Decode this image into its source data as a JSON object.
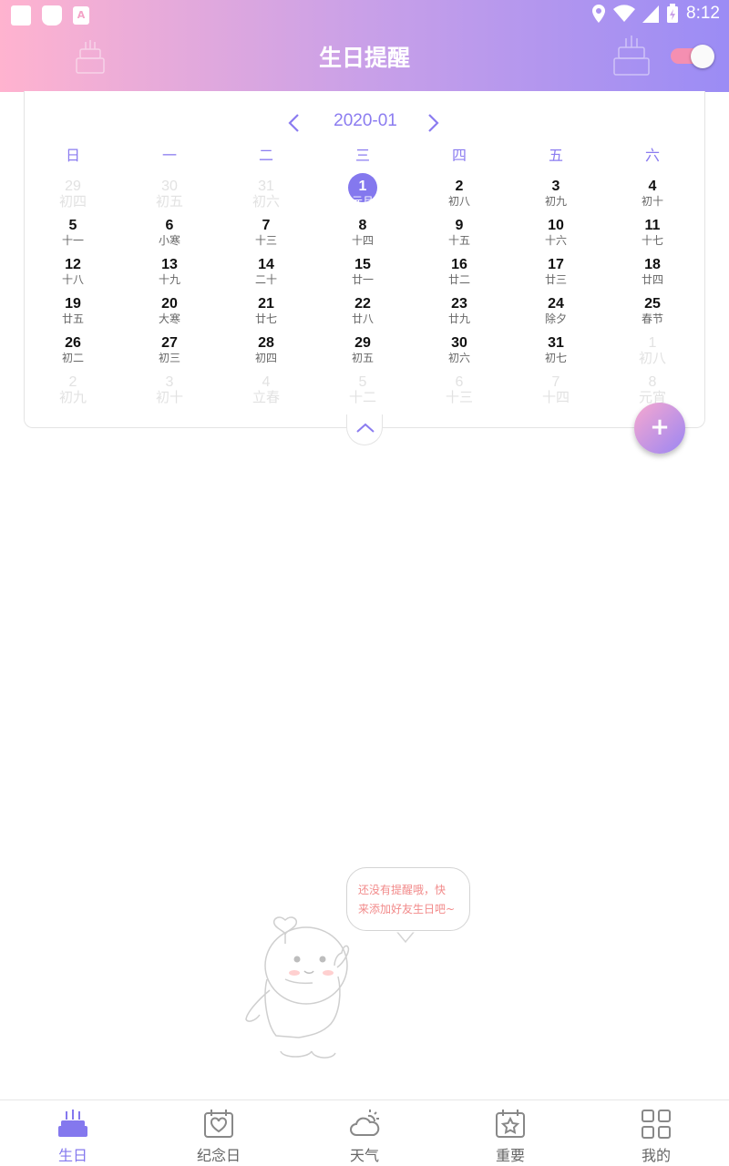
{
  "status_bar": {
    "time": "8:12"
  },
  "header": {
    "title": "生日提醒",
    "reminder_toggle_on": true
  },
  "calendar": {
    "month_label": "2020-01",
    "weekdays": [
      "日",
      "一",
      "二",
      "三",
      "四",
      "五",
      "六"
    ],
    "weeks": [
      [
        {
          "d": "29",
          "l": "初四",
          "o": true
        },
        {
          "d": "30",
          "l": "初五",
          "o": true
        },
        {
          "d": "31",
          "l": "初六",
          "o": true
        },
        {
          "d": "1",
          "l": "元旦",
          "sel": true
        },
        {
          "d": "2",
          "l": "初八"
        },
        {
          "d": "3",
          "l": "初九"
        },
        {
          "d": "4",
          "l": "初十"
        }
      ],
      [
        {
          "d": "5",
          "l": "十一"
        },
        {
          "d": "6",
          "l": "小寒"
        },
        {
          "d": "7",
          "l": "十三"
        },
        {
          "d": "8",
          "l": "十四"
        },
        {
          "d": "9",
          "l": "十五"
        },
        {
          "d": "10",
          "l": "十六"
        },
        {
          "d": "11",
          "l": "十七"
        }
      ],
      [
        {
          "d": "12",
          "l": "十八"
        },
        {
          "d": "13",
          "l": "十九"
        },
        {
          "d": "14",
          "l": "二十"
        },
        {
          "d": "15",
          "l": "廿一"
        },
        {
          "d": "16",
          "l": "廿二"
        },
        {
          "d": "17",
          "l": "廿三"
        },
        {
          "d": "18",
          "l": "廿四"
        }
      ],
      [
        {
          "d": "19",
          "l": "廿五"
        },
        {
          "d": "20",
          "l": "大寒"
        },
        {
          "d": "21",
          "l": "廿七"
        },
        {
          "d": "22",
          "l": "廿八"
        },
        {
          "d": "23",
          "l": "廿九"
        },
        {
          "d": "24",
          "l": "除夕"
        },
        {
          "d": "25",
          "l": "春节"
        }
      ],
      [
        {
          "d": "26",
          "l": "初二"
        },
        {
          "d": "27",
          "l": "初三"
        },
        {
          "d": "28",
          "l": "初四"
        },
        {
          "d": "29",
          "l": "初五"
        },
        {
          "d": "30",
          "l": "初六"
        },
        {
          "d": "31",
          "l": "初七"
        },
        {
          "d": "1",
          "l": "初八",
          "o": true
        }
      ],
      [
        {
          "d": "2",
          "l": "初九",
          "o": true
        },
        {
          "d": "3",
          "l": "初十",
          "o": true
        },
        {
          "d": "4",
          "l": "立春",
          "o": true
        },
        {
          "d": "5",
          "l": "十二",
          "o": true
        },
        {
          "d": "6",
          "l": "十三",
          "o": true
        },
        {
          "d": "7",
          "l": "十四",
          "o": true
        },
        {
          "d": "8",
          "l": "元宵",
          "o": true
        }
      ]
    ]
  },
  "fab": {
    "label": "+"
  },
  "empty_state": {
    "line1": "还没有提醒哦，快",
    "line2": "来添加好友生日吧~"
  },
  "tabs": [
    {
      "label": "生日",
      "icon": "cake-icon",
      "active": true
    },
    {
      "label": "纪念日",
      "icon": "calendar-heart-icon"
    },
    {
      "label": "天气",
      "icon": "weather-icon"
    },
    {
      "label": "重要",
      "icon": "calendar-star-icon"
    },
    {
      "label": "我的",
      "icon": "grid-icon"
    }
  ],
  "colors": {
    "accent": "#8478ee",
    "pink": "#f48fb1",
    "bubble_text": "#f28a8a"
  }
}
